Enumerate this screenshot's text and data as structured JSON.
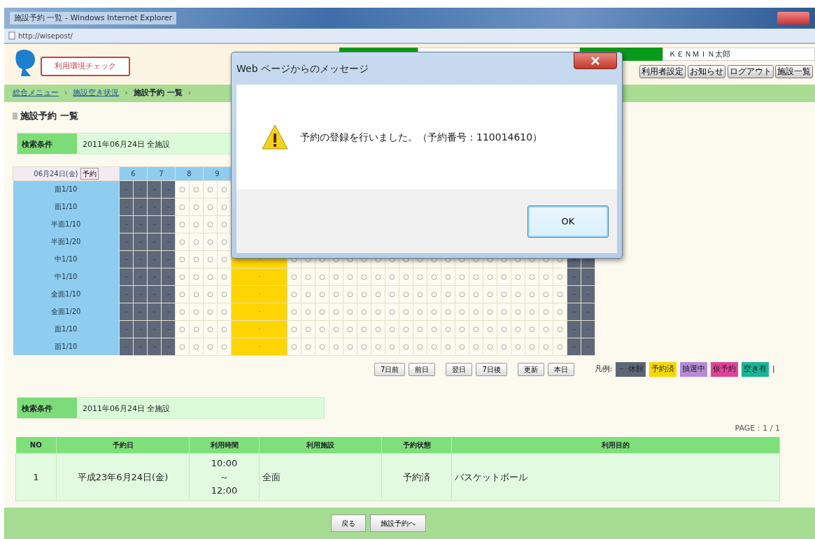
{
  "window": {
    "title": "施設予約 一覧 - Windows Internet Explorer",
    "address": "http://wisepost/"
  },
  "header": {
    "check_link": "利用環境チェック",
    "user_name": "ＫＥＮＭＩＮ太郎",
    "buttons": [
      "利用者設定",
      "お知らせ",
      "ログアウト",
      "施設一覧"
    ]
  },
  "breadcrumb": {
    "separator": "›",
    "items": [
      {
        "label": "総合メニュー",
        "link": true
      },
      {
        "label": "施設空き状況",
        "link": true
      },
      {
        "label": "施設予約 一覧",
        "link": false
      }
    ]
  },
  "heading": "施設予約 一覧",
  "search_top": {
    "label": "検索条件",
    "value": "2011年06月24日 全施設"
  },
  "grid": {
    "date": "06月24日(金)",
    "reserve_button": "予約",
    "hours": [
      "6",
      "7",
      "8",
      "9"
    ],
    "rows": [
      {
        "name": "面1/10",
        "segments": [
          {
            "kind": "closed",
            "marks": [
              "－",
              "－",
              "－",
              "－"
            ]
          },
          {
            "kind": "open",
            "marks": [
              "○",
              "○",
              "○",
              "○"
            ]
          }
        ]
      },
      {
        "name": "面1/10",
        "segments": [
          {
            "kind": "closed",
            "marks": [
              "－",
              "－",
              "－",
              "－"
            ]
          },
          {
            "kind": "open",
            "marks": [
              "○",
              "○",
              "○",
              "○"
            ]
          }
        ]
      },
      {
        "name": "半面1/10",
        "segments": [
          {
            "kind": "closed",
            "marks": [
              "－",
              "－",
              "－",
              "－"
            ]
          },
          {
            "kind": "open",
            "marks": [
              "○",
              "○",
              "○",
              "○"
            ]
          }
        ]
      },
      {
        "name": "半面1/20",
        "segments": [
          {
            "kind": "closed",
            "marks": [
              "－",
              "－",
              "－",
              "－"
            ]
          },
          {
            "kind": "open",
            "marks": [
              "○",
              "○",
              "○",
              "○"
            ]
          }
        ]
      },
      {
        "name": "中1/10",
        "segments": [
          {
            "kind": "closed",
            "marks": [
              "－",
              "－",
              "－",
              "－"
            ]
          },
          {
            "kind": "open",
            "marks": [
              "○",
              "○",
              "○",
              "○"
            ]
          },
          {
            "kind": "reserved",
            "marks": [
              "・"
            ]
          },
          {
            "kind": "open",
            "marks": [
              "○",
              "○",
              "○",
              "○",
              "○",
              "○",
              "○",
              "○",
              "○",
              "○",
              "○",
              "○",
              "○",
              "○",
              "○",
              "○",
              "○",
              "○",
              "○",
              "○"
            ]
          },
          {
            "kind": "closed",
            "marks": [
              "－",
              "－"
            ]
          }
        ]
      },
      {
        "name": "中1/10",
        "segments": [
          {
            "kind": "closed",
            "marks": [
              "－",
              "－",
              "－",
              "－"
            ]
          },
          {
            "kind": "open",
            "marks": [
              "○",
              "○",
              "○",
              "○"
            ]
          },
          {
            "kind": "reserved",
            "marks": [
              "・"
            ]
          },
          {
            "kind": "open",
            "marks": [
              "○",
              "○",
              "○",
              "○",
              "○",
              "○",
              "○",
              "○",
              "○",
              "○",
              "○",
              "○",
              "○",
              "○",
              "○",
              "○",
              "○",
              "○",
              "○",
              "○"
            ]
          },
          {
            "kind": "closed",
            "marks": [
              "－",
              "－"
            ]
          }
        ]
      },
      {
        "name": "全面1/10",
        "segments": [
          {
            "kind": "closed",
            "marks": [
              "－",
              "－",
              "－",
              "－"
            ]
          },
          {
            "kind": "open",
            "marks": [
              "○",
              "○",
              "○",
              "○"
            ]
          },
          {
            "kind": "reserved",
            "marks": [
              "・"
            ]
          },
          {
            "kind": "open",
            "marks": [
              "○",
              "○",
              "○",
              "○",
              "○",
              "○",
              "○",
              "○",
              "○",
              "○",
              "○",
              "○",
              "○",
              "○",
              "○",
              "○",
              "○",
              "○",
              "○",
              "○"
            ]
          },
          {
            "kind": "closed",
            "marks": [
              "－",
              "－"
            ]
          }
        ]
      },
      {
        "name": "全面1/20",
        "segments": [
          {
            "kind": "closed",
            "marks": [
              "－",
              "－",
              "－",
              "－"
            ]
          },
          {
            "kind": "open",
            "marks": [
              "○",
              "○",
              "○",
              "○"
            ]
          },
          {
            "kind": "reserved",
            "marks": [
              "・"
            ]
          },
          {
            "kind": "open",
            "marks": [
              "○",
              "○",
              "○",
              "○",
              "○",
              "○",
              "○",
              "○",
              "○",
              "○",
              "○",
              "○",
              "○",
              "○",
              "○",
              "○",
              "○",
              "○",
              "○",
              "○"
            ]
          },
          {
            "kind": "closed",
            "marks": [
              "－",
              "－"
            ]
          }
        ]
      },
      {
        "name": "面1/10",
        "segments": [
          {
            "kind": "closed",
            "marks": [
              "－",
              "－",
              "－",
              "－"
            ]
          },
          {
            "kind": "open",
            "marks": [
              "○",
              "○",
              "○",
              "○"
            ]
          },
          {
            "kind": "reserved",
            "marks": [
              "・"
            ]
          },
          {
            "kind": "open",
            "marks": [
              "○",
              "○",
              "○",
              "○",
              "○",
              "○",
              "○",
              "○",
              "○",
              "○",
              "○",
              "○",
              "○",
              "○",
              "○",
              "○",
              "○",
              "○",
              "○",
              "○"
            ]
          },
          {
            "kind": "closed",
            "marks": [
              "－",
              "－"
            ]
          }
        ]
      },
      {
        "name": "面1/10",
        "segments": [
          {
            "kind": "closed",
            "marks": [
              "－",
              "－",
              "－",
              "－"
            ]
          },
          {
            "kind": "open",
            "marks": [
              "○",
              "○",
              "○",
              "○"
            ]
          },
          {
            "kind": "reserved",
            "marks": [
              "・"
            ]
          },
          {
            "kind": "open",
            "marks": [
              "○",
              "○",
              "○",
              "○",
              "○",
              "○",
              "○",
              "○",
              "○",
              "○",
              "○",
              "○",
              "○",
              "○",
              "○",
              "○",
              "○",
              "○",
              "○",
              "○"
            ]
          },
          {
            "kind": "closed",
            "marks": [
              "－",
              "－"
            ]
          }
        ]
      }
    ]
  },
  "nav_buttons": [
    "7日前",
    "前日",
    "翌日",
    "7日後",
    "更新",
    "本日"
  ],
  "legend": {
    "label": "凡例:",
    "items": [
      {
        "text": "－ 休館",
        "color": "#5d6677"
      },
      {
        "text": "予約済",
        "color": "#f5d800"
      },
      {
        "text": "抽選中",
        "color": "#b58ad6"
      },
      {
        "text": "仮予約",
        "color": "#e0449a"
      },
      {
        "text": "空き有",
        "color": "#17b496"
      }
    ],
    "end": "|"
  },
  "search_bottom": {
    "label": "検索条件",
    "value": "2011年06月24日 全施設"
  },
  "page": "PAGE：1 / 1",
  "results": {
    "columns": [
      "NO",
      "予約日",
      "利用時間",
      "利用施設",
      "予約状態",
      "利用目的"
    ],
    "rows": [
      {
        "cells": [
          "1",
          "平成23年6月24日(金)",
          "10:00 ～ 12:00",
          "全面",
          "予約済",
          "バスケットボール"
        ]
      }
    ]
  },
  "footer_buttons": [
    "戻る",
    "施設予約へ"
  ],
  "dialog": {
    "title": "Web ページからのメッセージ",
    "message": "予約の登録を行いました。（予約番号：110014610）",
    "ok": "OK"
  }
}
